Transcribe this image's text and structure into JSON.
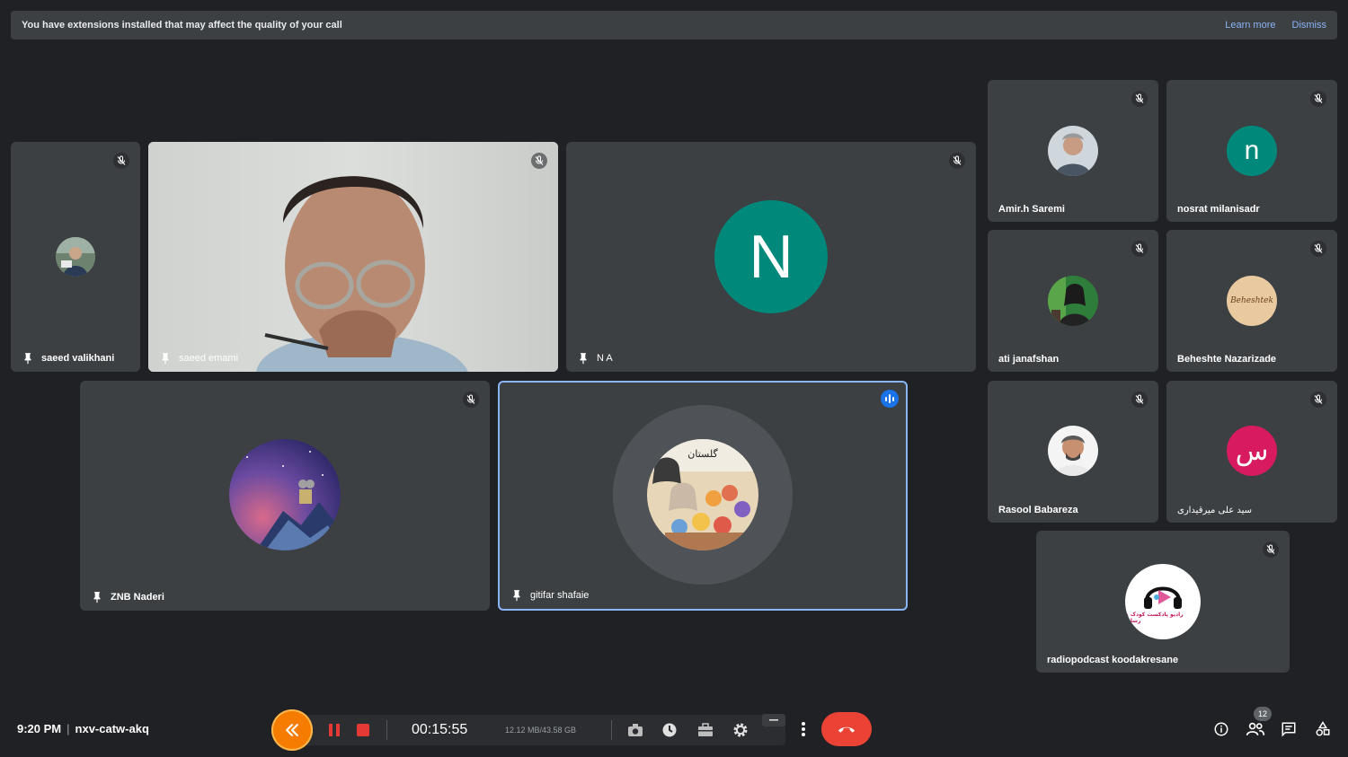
{
  "banner": {
    "message": "You have extensions installed that may affect the quality of your call",
    "learn_more": "Learn more",
    "dismiss": "Dismiss"
  },
  "participants": [
    {
      "name": "saeed valikhani"
    },
    {
      "name": "saeed emami"
    },
    {
      "name": "N A",
      "letter": "N",
      "color": "#00897b"
    },
    {
      "name": "Amir.h Saremi"
    },
    {
      "name": "nosrat milanisadr",
      "letter": "n",
      "color": "#00897b"
    },
    {
      "name": "ati janafshan"
    },
    {
      "name": "Beheshte Nazarizade",
      "avatar_text": "Beheshtek"
    },
    {
      "name": "ZNB Naderi"
    },
    {
      "name": "gitifar shafaie",
      "avatar_text": "گلستان"
    },
    {
      "name": "Rasool Babareza"
    },
    {
      "name": "سید علی میرقیداری",
      "letter": "س",
      "color": "#d81b60"
    },
    {
      "name": "radiopodcast koodakresane",
      "avatar_text": "رادیو پادکست کودک و رسانه"
    }
  ],
  "meeting": {
    "time": "9:20 PM",
    "separator": "|",
    "code": "nxv-catw-akq"
  },
  "recorder": {
    "timer": "00:15:55",
    "size": "12.12 MB/43.58 GB"
  },
  "people_count": "12",
  "colors": {
    "background": "#202124",
    "tile": "#3c4043",
    "active_border": "#8ab4f8",
    "end_call": "#ea4335",
    "recorder_orange": "#f57c00",
    "recorder_red": "#e53935"
  }
}
